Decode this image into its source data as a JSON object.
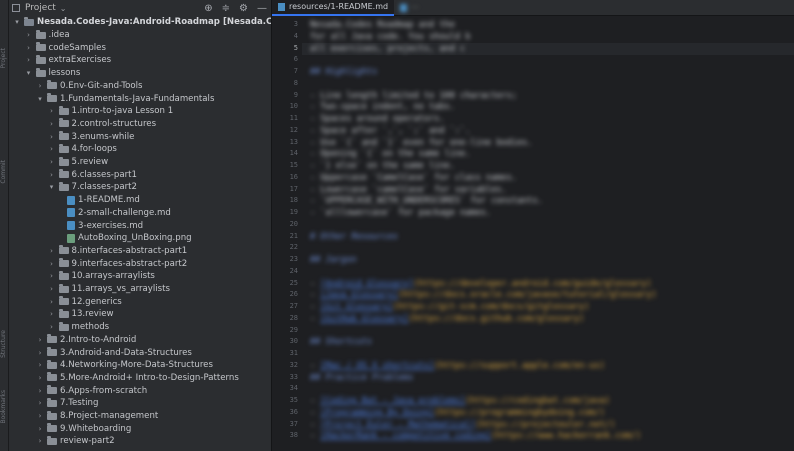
{
  "side_labels": [
    "Project",
    "Commit",
    "Structure",
    "Bookmarks"
  ],
  "project_panel": {
    "title": "Project",
    "tools": [
      "⊕",
      "≑",
      "⚙",
      "—"
    ]
  },
  "tree": [
    {
      "indent": 0,
      "arrow": "▾",
      "kind": "root",
      "label": "Nesada.Codes-Java:Android-Roadmap [Nesada.Codes-Java"
    },
    {
      "indent": 1,
      "arrow": "›",
      "kind": "folder",
      "label": ".idea"
    },
    {
      "indent": 1,
      "arrow": "›",
      "kind": "folder",
      "label": "codeSamples"
    },
    {
      "indent": 1,
      "arrow": "›",
      "kind": "folder",
      "label": "extraExercises"
    },
    {
      "indent": 1,
      "arrow": "▾",
      "kind": "folder",
      "label": "lessons"
    },
    {
      "indent": 2,
      "arrow": "›",
      "kind": "folder",
      "label": "0.Env-Git-and-Tools"
    },
    {
      "indent": 2,
      "arrow": "▾",
      "kind": "folder",
      "label": "1.Fundamentals-Java-Fundamentals"
    },
    {
      "indent": 3,
      "arrow": "›",
      "kind": "folder",
      "label": "1.intro-to-java Lesson 1"
    },
    {
      "indent": 3,
      "arrow": "›",
      "kind": "folder",
      "label": "2.control-structures"
    },
    {
      "indent": 3,
      "arrow": "›",
      "kind": "folder",
      "label": "3.enums-while"
    },
    {
      "indent": 3,
      "arrow": "›",
      "kind": "folder",
      "label": "4.for-loops"
    },
    {
      "indent": 3,
      "arrow": "›",
      "kind": "folder",
      "label": "5.review"
    },
    {
      "indent": 3,
      "arrow": "›",
      "kind": "folder",
      "label": "6.classes-part1"
    },
    {
      "indent": 3,
      "arrow": "▾",
      "kind": "folder",
      "label": "7.classes-part2"
    },
    {
      "indent": 4,
      "arrow": "",
      "kind": "md",
      "label": "1-README.md"
    },
    {
      "indent": 4,
      "arrow": "",
      "kind": "md",
      "label": "2-small-challenge.md"
    },
    {
      "indent": 4,
      "arrow": "",
      "kind": "md",
      "label": "3-exercises.md"
    },
    {
      "indent": 4,
      "arrow": "",
      "kind": "png",
      "label": "AutoBoxing_UnBoxing.png"
    },
    {
      "indent": 3,
      "arrow": "›",
      "kind": "folder",
      "label": "8.interfaces-abstract-part1"
    },
    {
      "indent": 3,
      "arrow": "›",
      "kind": "folder",
      "label": "9.interfaces-abstract-part2"
    },
    {
      "indent": 3,
      "arrow": "›",
      "kind": "folder",
      "label": "10.arrays-arraylists"
    },
    {
      "indent": 3,
      "arrow": "›",
      "kind": "folder",
      "label": "11.arrays_vs_arraylists"
    },
    {
      "indent": 3,
      "arrow": "›",
      "kind": "folder",
      "label": "12.generics"
    },
    {
      "indent": 3,
      "arrow": "›",
      "kind": "folder",
      "label": "13.review"
    },
    {
      "indent": 3,
      "arrow": "›",
      "kind": "folder",
      "label": "methods"
    },
    {
      "indent": 2,
      "arrow": "›",
      "kind": "folder",
      "label": "2.Intro-to-Android"
    },
    {
      "indent": 2,
      "arrow": "›",
      "kind": "folder",
      "label": "3.Android-and-Data-Structures"
    },
    {
      "indent": 2,
      "arrow": "›",
      "kind": "folder",
      "label": "4.Networking-More-Data-Structures"
    },
    {
      "indent": 2,
      "arrow": "›",
      "kind": "folder",
      "label": "5.More-Android+ Intro-to-Design-Patterns"
    },
    {
      "indent": 2,
      "arrow": "›",
      "kind": "folder",
      "label": "6.Apps-from-scratch"
    },
    {
      "indent": 2,
      "arrow": "›",
      "kind": "folder",
      "label": "7.Testing"
    },
    {
      "indent": 2,
      "arrow": "›",
      "kind": "folder",
      "label": "8.Project-management"
    },
    {
      "indent": 2,
      "arrow": "›",
      "kind": "folder",
      "label": "9.Whiteboarding"
    },
    {
      "indent": 2,
      "arrow": "›",
      "kind": "folder",
      "label": "review-part2"
    }
  ],
  "editor": {
    "tabs": [
      {
        "label": "resources/1-README.md",
        "active": true
      },
      {
        "label": "···",
        "active": false
      }
    ],
    "current_line": 5,
    "lines": [
      {
        "n": 3,
        "style": "text",
        "text": "Nesada.Codes Roadmap and the "
      },
      {
        "n": 4,
        "style": "text",
        "text": "for all Java code. You should b"
      },
      {
        "n": 5,
        "style": "text",
        "text": "all exercises, projects, and c"
      },
      {
        "n": 6,
        "style": "text",
        "text": ""
      },
      {
        "n": 7,
        "style": "heading",
        "text": "## Highlights"
      },
      {
        "n": 8,
        "style": "text",
        "text": ""
      },
      {
        "n": 9,
        "style": "text",
        "text": "- Line length limited to 100 characters;"
      },
      {
        "n": 10,
        "style": "text",
        "text": "- Two-space indent, no tabs."
      },
      {
        "n": 11,
        "style": "text",
        "text": "- Spaces around operators."
      },
      {
        "n": 12,
        "style": "text",
        "text": "- Space after `,`, `;` and `:`."
      },
      {
        "n": 13,
        "style": "text",
        "text": "- Use `{` and `}` even for one-line bodies."
      },
      {
        "n": 14,
        "style": "text",
        "text": "- Opening `{` on the same line."
      },
      {
        "n": 15,
        "style": "text",
        "text": "- `} else` on the same line."
      },
      {
        "n": 16,
        "style": "text",
        "text": "- Uppercase `CamelCase` for class names."
      },
      {
        "n": 17,
        "style": "text",
        "text": "- Lowercase `camelCase` for variables."
      },
      {
        "n": 18,
        "style": "text",
        "text": "- `UPPERCASE_WITH_UNDERSCORES` for constants."
      },
      {
        "n": 19,
        "style": "text",
        "text": "- `alllowercase` for package names."
      },
      {
        "n": 20,
        "style": "text",
        "text": ""
      },
      {
        "n": 21,
        "style": "heading",
        "text": "# Other Resources"
      },
      {
        "n": 22,
        "style": "text",
        "text": ""
      },
      {
        "n": 23,
        "style": "heading",
        "text": "## Jargon"
      },
      {
        "n": 24,
        "style": "text",
        "text": ""
      },
      {
        "n": 25,
        "style": "link",
        "text": "- [Android Glossary](https://developer.android.com/guide/glossary)"
      },
      {
        "n": 26,
        "style": "link",
        "text": "- [Java Glossary](https://docs.oracle.com/javase/tutorial/glossary)"
      },
      {
        "n": 27,
        "style": "link",
        "text": "- [Git Glossary](https://git-scm.com/docs/gitglossary)"
      },
      {
        "n": 28,
        "style": "link",
        "text": "- [GitHub Glossary](https://docs.github.com/glossary)"
      },
      {
        "n": 29,
        "style": "text",
        "text": ""
      },
      {
        "n": 30,
        "style": "heading",
        "text": "## Shortcuts"
      },
      {
        "n": 31,
        "style": "text",
        "text": ""
      },
      {
        "n": 32,
        "style": "link",
        "text": "- [Mac / OS X shortcuts](https://support.apple.com/en-us)"
      },
      {
        "n": 33,
        "style": "heading",
        "text": "## Practice Problems"
      },
      {
        "n": 34,
        "style": "text",
        "text": ""
      },
      {
        "n": 35,
        "style": "link",
        "text": "- [Coding Bat - Java problems](https://codingbat.com/java)"
      },
      {
        "n": 36,
        "style": "link",
        "text": "- [Programming By Doing](https://programmingbydoing.com/)"
      },
      {
        "n": 37,
        "style": "link",
        "text": "- [Project Euler - Mathematical](https://projecteuler.net/)"
      },
      {
        "n": 38,
        "style": "link",
        "text": "- [HackerRank - competitive coding](https://www.hackerrank.com/)"
      }
    ]
  },
  "colors": {
    "panel_bg": "#2b2d30",
    "editor_bg": "#1e1f22",
    "link": "#4f7fe0",
    "url": "#d8a641",
    "heading": "#6f8fd8",
    "accent": "#3574f0"
  }
}
